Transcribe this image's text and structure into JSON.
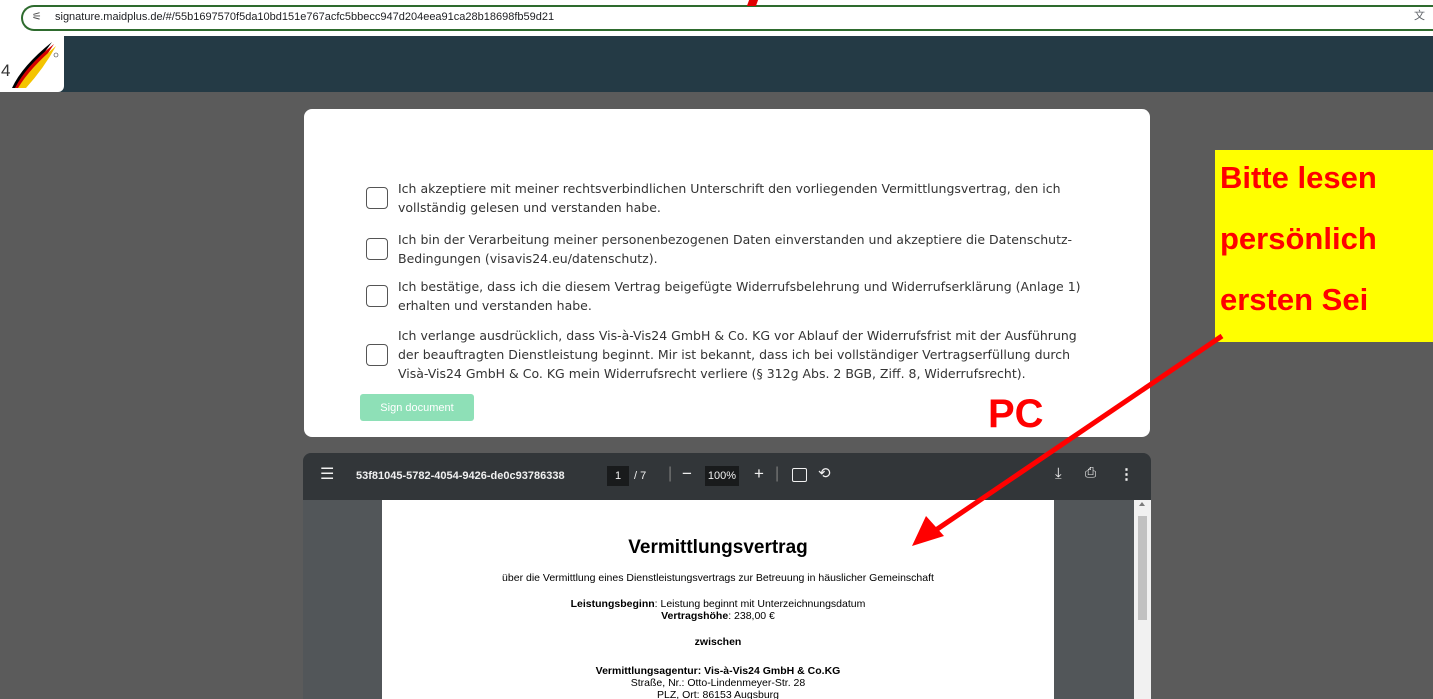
{
  "browser": {
    "url": "signature.maidplus.de/#/55b1697570f5da10bd151e767acfc5bbecc947d204eea91ca28b18698fb59d21",
    "site_info_icon": "tune-icon",
    "translate_icon": "translate-icon"
  },
  "header": {
    "logo_char": "4"
  },
  "consent": {
    "items": [
      {
        "label": "Ich akzeptiere mit meiner rechtsverbindlichen Unterschrift den vorliegenden Vermittlungsvertrag, den ich vollständig gelesen und verstanden habe.",
        "checked": false
      },
      {
        "label": "Ich bin der Verarbeitung meiner personenbezogenen Daten einverstanden und akzeptiere die Datenschutz-Bedingungen (visavis24.eu/datenschutz).",
        "checked": false
      },
      {
        "label": "Ich bestätige, dass ich die diesem Vertrag beigefügte Widerrufsbelehrung und Widerrufserklärung (Anlage 1) erhalten und verstanden habe.",
        "checked": false
      },
      {
        "label": "Ich verlange ausdrücklich, dass Vis-à-Vis24 GmbH & Co. KG vor Ablauf der Widerrufsfrist mit der Ausführung der beauftragten Dienstleistung beginnt. Mir ist bekannt, dass ich bei vollständiger Vertragserfüllung durch Visà-Vis24 GmbH & Co. KG mein Widerrufsrecht verliere (§ 312g Abs. 2 BGB, Ziff. 8, Widerrufsrecht).",
        "checked": false
      }
    ],
    "sign_button": "Sign document"
  },
  "pdf": {
    "filename": "53f81045-5782-4054-9426-de0c93786338",
    "page_current": "1",
    "page_total": "/ 7",
    "zoom": "100%",
    "menu_icon": "menu-icon",
    "document": {
      "title": "Vermittlungsvertrag",
      "subtitle": "über die Vermittlung eines Dienstleistungsvertrags zur Betreuung in häuslicher Gemeinschaft",
      "start_label": "Leistungsbeginn",
      "start_value": ": Leistung beginnt mit Unterzeichnungsdatum",
      "amount_label": "Vertragshöhe",
      "amount_value": ": 238,00 €",
      "between": "zwischen",
      "agency": "Vermittlungsagentur: Vis-à-Vis24 GmbH & Co.KG",
      "street": "Straße, Nr.: Otto-Lindenmeyer-Str. 28",
      "city": "PLZ, Ort: 86153 Augsburg"
    }
  },
  "annotation": {
    "lines": [
      "Bitte lesen",
      "persönlich",
      "ersten Sei"
    ],
    "pc_label": "PC",
    "color": "#ff0000",
    "highlight": "#ffff00"
  }
}
